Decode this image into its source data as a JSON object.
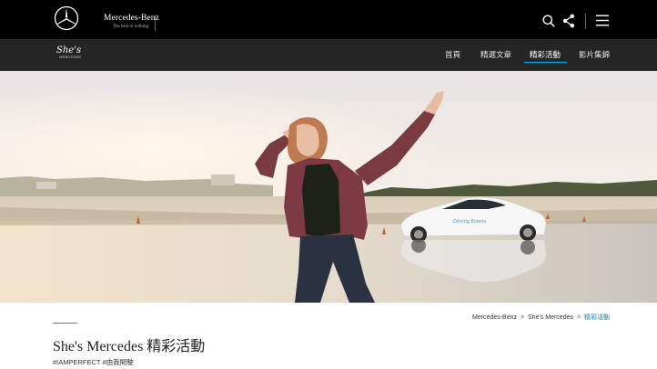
{
  "header": {
    "brand_name": "Mercedes-Benz",
    "brand_tagline": "The best or nothing."
  },
  "subheader": {
    "logo_text": "She's",
    "logo_subtext": "MERCEDES"
  },
  "nav": {
    "items": [
      {
        "label": "首頁",
        "active": false
      },
      {
        "label": "精選文章",
        "active": false
      },
      {
        "label": "精彩活動",
        "active": true
      },
      {
        "label": "影片集錦",
        "active": false
      }
    ]
  },
  "hero": {
    "car_badge_text": "Driving Events"
  },
  "breadcrumb": {
    "items": [
      "Mercedes-Benz",
      "She's Mercedes",
      "精彩活動"
    ],
    "separator": ">"
  },
  "page": {
    "title": "She's Mercedes 精彩活動",
    "hashtags": "#IAMPERFECT #由我開駛"
  },
  "colors": {
    "accent": "#00adef",
    "breadcrumb_current": "#0088c6",
    "topbar": "#000000",
    "navbar": "#252525"
  },
  "icons": [
    "mercedes-star-icon",
    "search-icon",
    "share-icon",
    "menu-icon"
  ]
}
